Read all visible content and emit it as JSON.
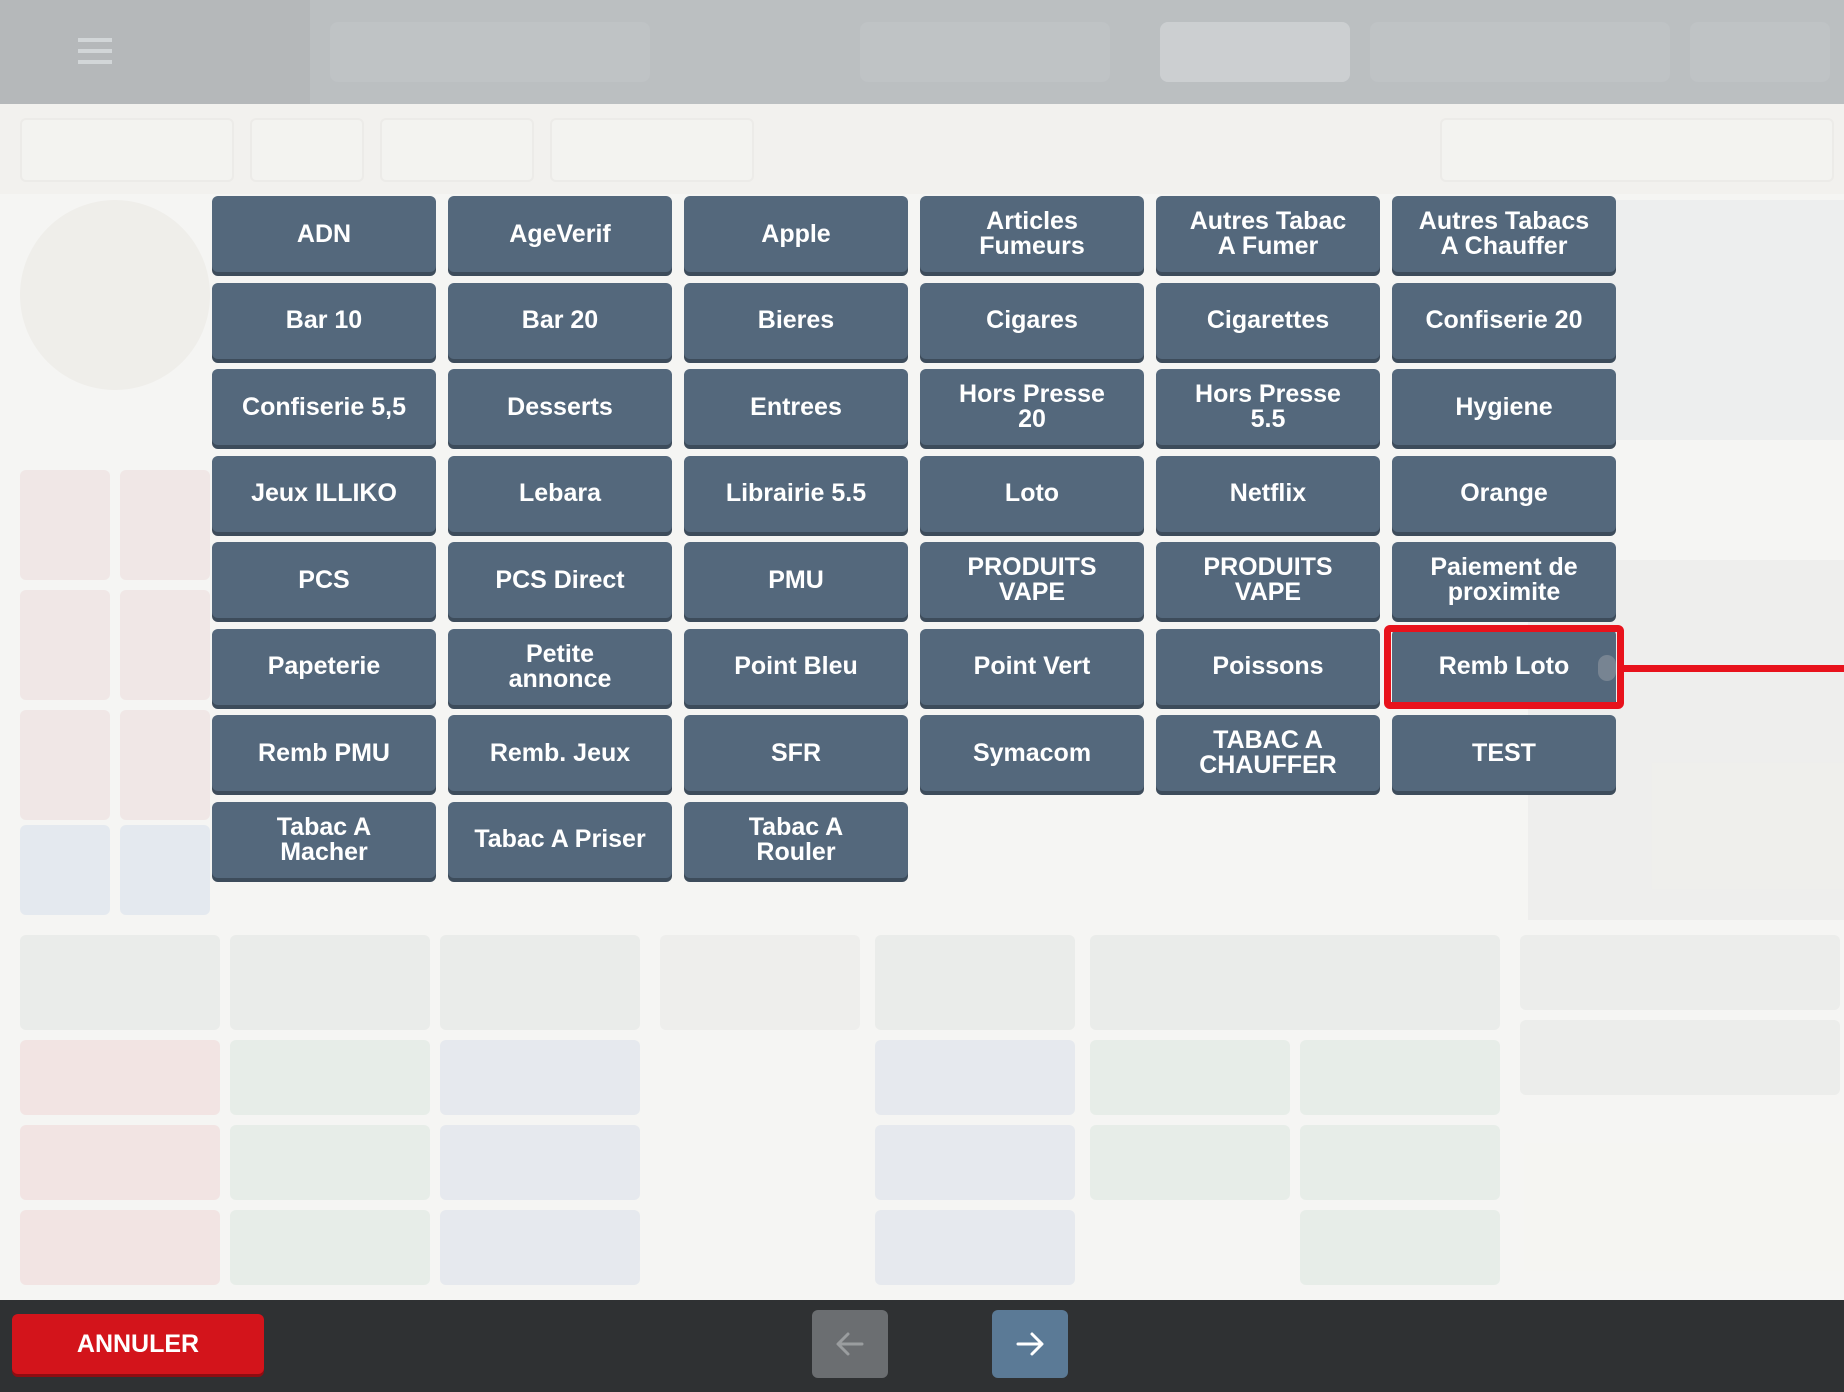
{
  "categories": [
    "ADN",
    "AgeVerif",
    "Apple",
    "Articles\nFumeurs",
    "Autres Tabac\nA Fumer",
    "Autres Tabacs\nA Chauffer",
    "Bar 10",
    "Bar 20",
    "Bieres",
    "Cigares",
    "Cigarettes",
    "Confiserie 20",
    "Confiserie 5,5",
    "Desserts",
    "Entrees",
    "Hors Presse\n20",
    "Hors Presse\n5.5",
    "Hygiene",
    "Jeux ILLIKO",
    "Lebara",
    "Librairie 5.5",
    "Loto",
    "Netflix",
    "Orange",
    "PCS",
    "PCS Direct",
    "PMU",
    "PRODUITS\nVAPE",
    "PRODUITS\nVAPE",
    "Paiement de\nproximite",
    "Papeterie",
    "Petite\nannonce",
    "Point Bleu",
    "Point Vert",
    "Poissons",
    "Remb Loto",
    "Remb PMU",
    "Remb. Jeux",
    "SFR",
    "Symacom",
    "TABAC A\nCHAUFFER",
    "TEST",
    "Tabac A\nMacher",
    "Tabac A Priser",
    "Tabac A\nRouler"
  ],
  "highlighted_category": "Remb Loto",
  "bottom_bar": {
    "cancel_label": "ANNULER",
    "prev_icon": "arrow-left-icon",
    "next_icon": "arrow-right-icon"
  },
  "colors": {
    "button": "#54687c",
    "highlight": "#e8121c",
    "cancel": "#d3141b",
    "bottom_bar": "#2f3133"
  }
}
